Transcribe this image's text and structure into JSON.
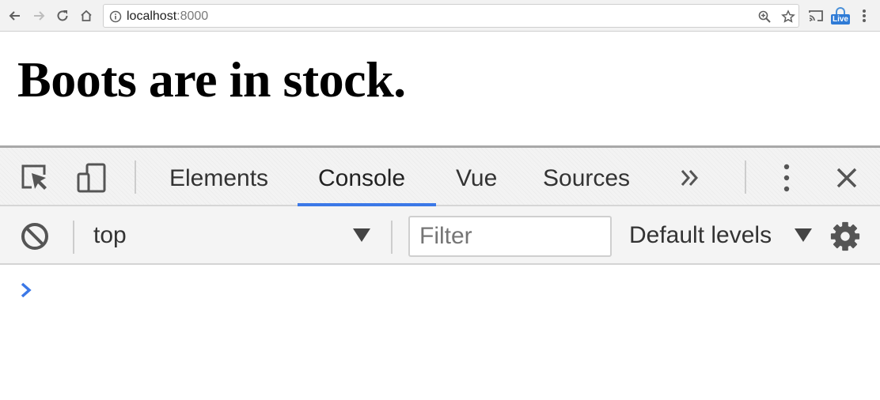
{
  "browser": {
    "url_host": "localhost",
    "url_port": ":8000",
    "extension_badge": "Live"
  },
  "page": {
    "heading": "Boots are in stock."
  },
  "devtools": {
    "tabs": [
      {
        "label": "Elements",
        "active": false
      },
      {
        "label": "Console",
        "active": true
      },
      {
        "label": "Vue",
        "active": false
      },
      {
        "label": "Sources",
        "active": false
      }
    ],
    "more_tabs_icon": "double-chevron-right-icon",
    "console": {
      "context": "top",
      "filter_placeholder": "Filter",
      "filter_value": "",
      "levels": "Default levels"
    }
  },
  "colors": {
    "accent": "#3b78e7",
    "toolbar_bg": "#f3f3f3",
    "prompt": "#3b78e7"
  }
}
